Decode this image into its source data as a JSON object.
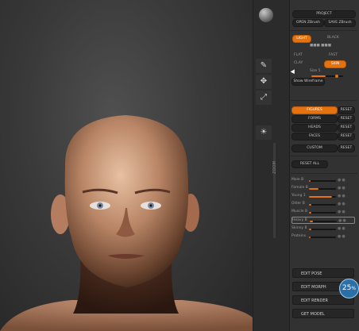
{
  "viewport": {
    "zoom_badge": "25",
    "zoom_unit": "%"
  },
  "toolstrip": {
    "buttons": [
      {
        "label": "Edit",
        "icon": "edit-icon"
      },
      {
        "label": "Move",
        "icon": "move-icon"
      },
      {
        "label": "Scale",
        "icon": "scale-icon"
      },
      {
        "label": "Rotate",
        "icon": "rotate-icon"
      },
      {
        "label": "Light",
        "icon": "light-icon"
      }
    ],
    "slider_label": "ZOOM"
  },
  "panel": {
    "top_button": "PROJECT",
    "open": "OPEN ZBrush",
    "save": "SAVE ZBrush",
    "color_on": "LIGHT",
    "color_off": "BLACK",
    "tiny_label": "■■■ ■■■",
    "flat": "FLAT",
    "fast": "FAST",
    "clay": "CLAY",
    "skin": "SKIN",
    "size_label": "Size 5",
    "show_label": "Show Wireframe",
    "tabs": [
      {
        "label": "FIGURES",
        "reset": "RESET",
        "on": true
      },
      {
        "label": "FORMS",
        "reset": "RESET",
        "on": false
      },
      {
        "label": "HEADS",
        "reset": "RESET",
        "on": false
      },
      {
        "label": "FACES",
        "reset": "RESET",
        "on": false
      }
    ],
    "custom": "CUSTOM",
    "custom_reset": "RESET",
    "reset_all": "RESET ALL",
    "morphs": [
      {
        "label": "Male B",
        "value": 0.05
      },
      {
        "label": "Female B",
        "value": 0.35
      },
      {
        "label": "Young 1",
        "value": 0.85
      },
      {
        "label": "Older B",
        "value": 0.1
      },
      {
        "label": "Muscle B",
        "value": 0.08
      },
      {
        "label": "Heavy B",
        "value": 0.12
      },
      {
        "label": "Skinny B",
        "value": 0.1
      },
      {
        "label": "Proteins",
        "value": 0.05
      }
    ],
    "bottom": [
      "EDIT POSE",
      "EDIT MORPH",
      "EDIT RENDER",
      "GET MODEL"
    ]
  }
}
